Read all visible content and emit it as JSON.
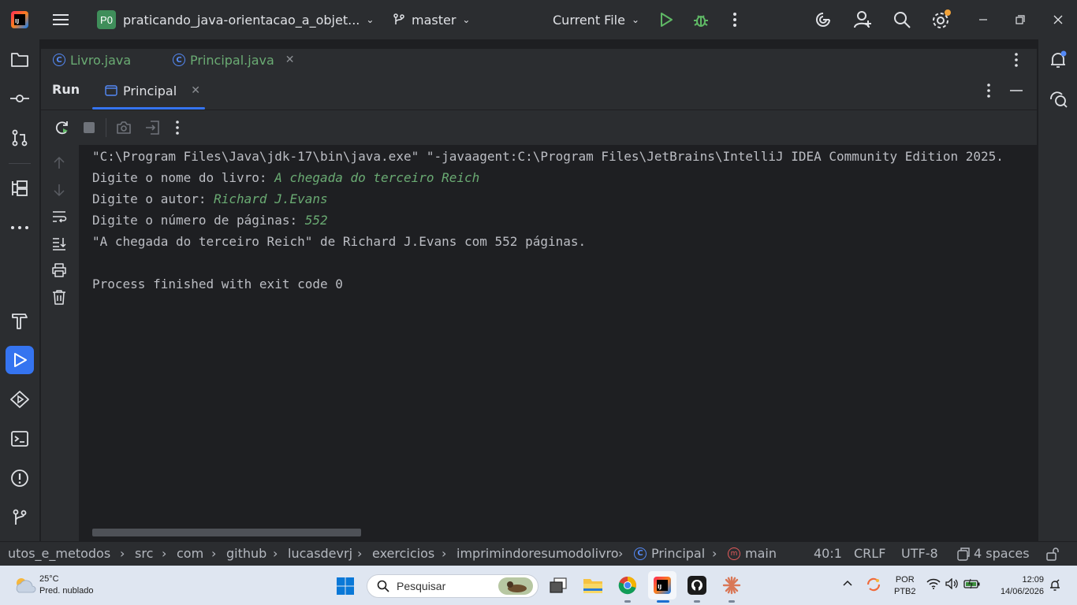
{
  "titlebar": {
    "project_badge": "P0",
    "project_name": "praticando_java-orientacao_a_objet...",
    "branch": "master",
    "run_config": "Current File"
  },
  "editor_tabs": [
    {
      "label": "Livro.java"
    },
    {
      "label": "Principal.java"
    }
  ],
  "run_panel": {
    "title": "Run",
    "tab_label": "Principal"
  },
  "console": {
    "lines": [
      {
        "text": "\"C:\\Program Files\\Java\\jdk-17\\bin\\java.exe\" \"-javaagent:C:\\Program Files\\JetBrains\\IntelliJ IDEA Community Edition 2025.",
        "input": ""
      },
      {
        "text": "Digite o nome do livro: ",
        "input": "A chegada do terceiro Reich"
      },
      {
        "text": "Digite o autor: ",
        "input": "Richard J.Evans"
      },
      {
        "text": "Digite o número de páginas: ",
        "input": "552"
      },
      {
        "text": "\"A chegada do terceiro Reich\" de Richard J.Evans com 552 páginas.",
        "input": ""
      },
      {
        "text": "",
        "input": ""
      },
      {
        "text": "Process finished with exit code 0",
        "input": ""
      }
    ]
  },
  "breadcrumbs": [
    "utos_e_metodos",
    "src",
    "com",
    "github",
    "lucasdevrj",
    "exercicios",
    "imprimindoresumodolivro",
    "Principal",
    "main"
  ],
  "status": {
    "position": "40:1",
    "line_ending": "CRLF",
    "encoding": "UTF-8",
    "indent": "4 spaces"
  },
  "taskbar": {
    "weather_temp": "25°C",
    "weather_desc": "Pred. nublado",
    "search_placeholder": "Pesquisar",
    "lang_1": "POR",
    "lang_2": "PTB2",
    "time": "12:09",
    "date": "14/06/2026"
  },
  "colors": {
    "accent": "#3574f0",
    "console_input": "#6aab73",
    "panel_bg": "#2b2d30",
    "editor_bg": "#1e1f22"
  }
}
